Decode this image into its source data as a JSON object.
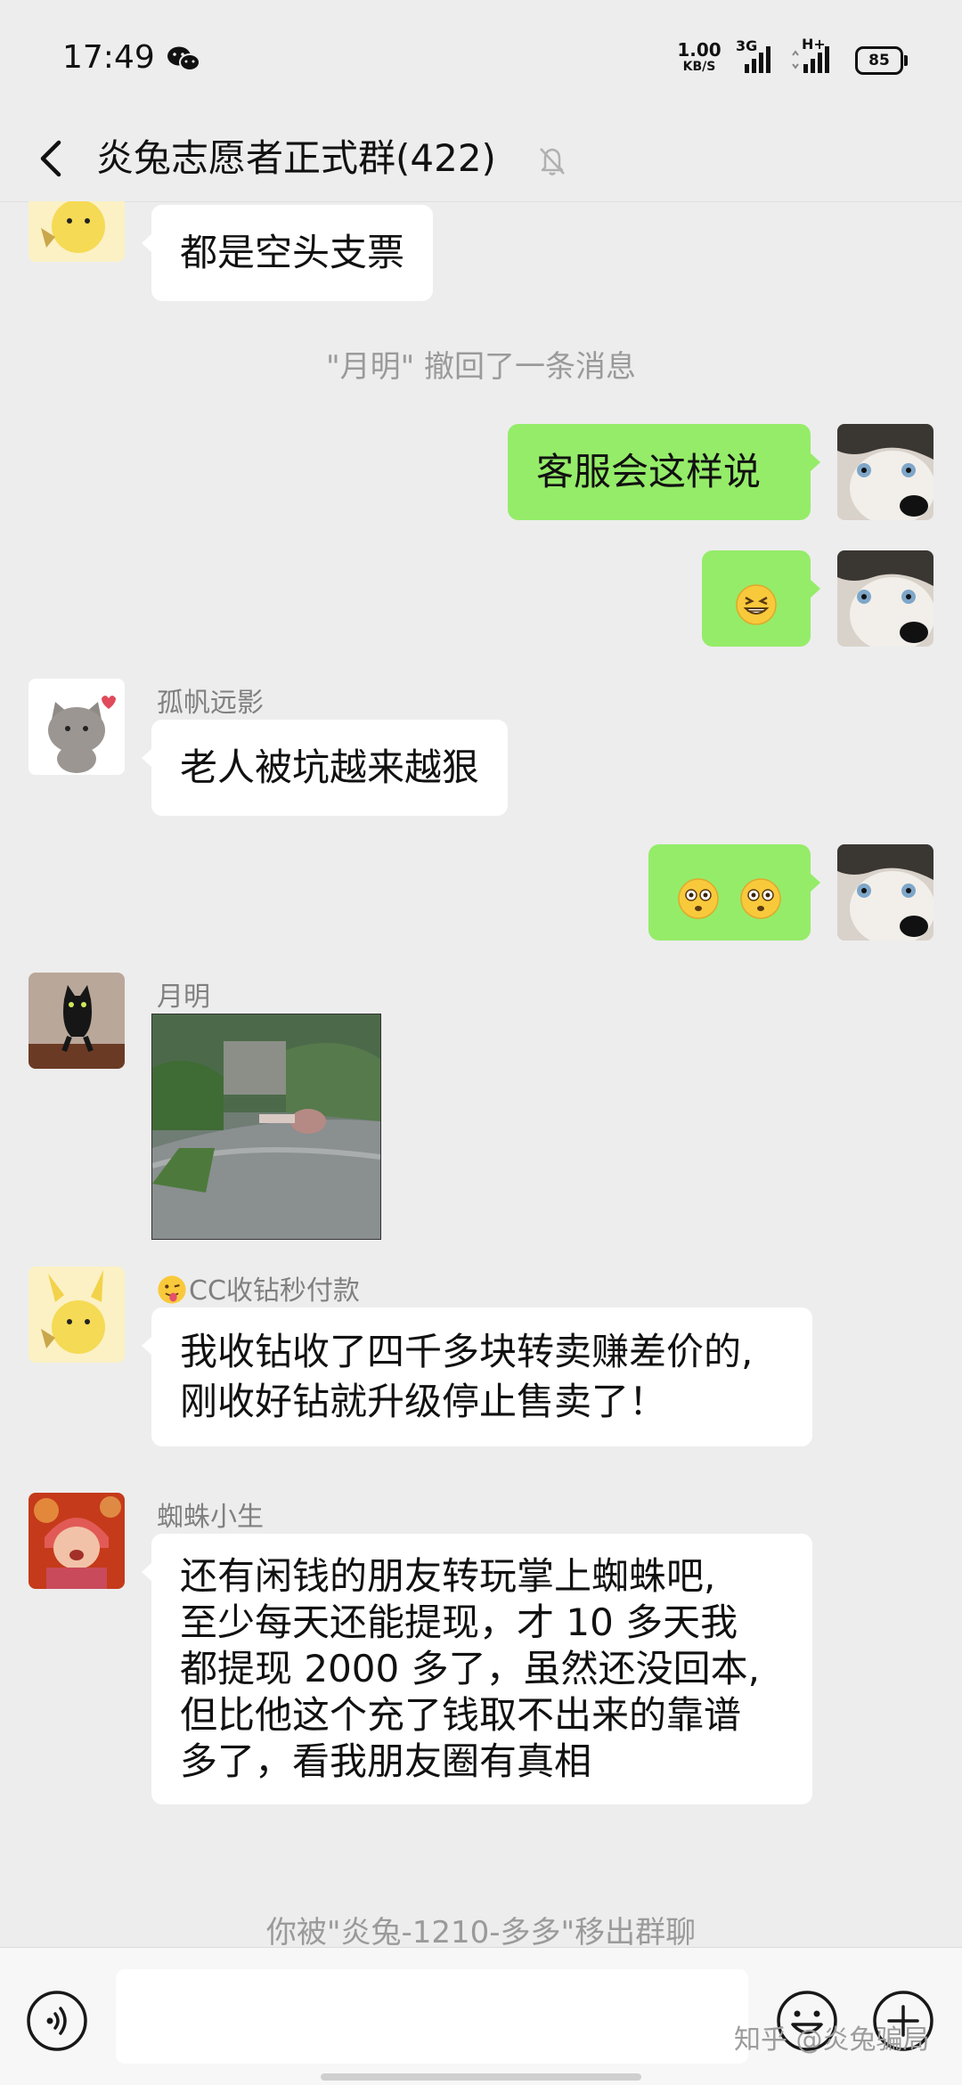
{
  "status_bar": {
    "time": "17:49",
    "speed_value": "1.00",
    "speed_unit": "KB/S",
    "network_1": "3G",
    "network_2": "H+",
    "battery": "85"
  },
  "header": {
    "title": "炎兔志愿者正式群(422)",
    "mute_icon": "bell-mute-icon"
  },
  "messages": [
    {
      "type": "text",
      "side": "left",
      "sender": "",
      "avatar": "pikachu",
      "text": "都是空头支票"
    },
    {
      "type": "system",
      "text": "\"月明\" 撤回了一条消息"
    },
    {
      "type": "text",
      "side": "right",
      "avatar": "husky",
      "text": "客服会这样说"
    },
    {
      "type": "emoji",
      "side": "right",
      "avatar": "husky",
      "emojis": [
        "grinning-squint-emoji"
      ]
    },
    {
      "type": "text",
      "side": "left",
      "sender": "孤帆远影",
      "avatar": "cat-cartoon",
      "text": "老人被坑越来越狠"
    },
    {
      "type": "emoji",
      "side": "right",
      "avatar": "husky",
      "emojis": [
        "flushed-emoji",
        "flushed-emoji"
      ]
    },
    {
      "type": "image",
      "side": "left",
      "sender": "月明",
      "avatar": "black-cat",
      "image": "street-photo"
    },
    {
      "type": "text",
      "side": "left",
      "sender": "CC收钻秒付款",
      "sender_emoji": "tongue-emoji",
      "avatar": "pikachu",
      "lines": [
        "我收钻收了四千多块转卖赚差价的,",
        "刚收好钻就升级停止售卖了！"
      ]
    },
    {
      "type": "text",
      "side": "left",
      "sender": "蜘蛛小生",
      "avatar": "baby",
      "lines": [
        "还有闲钱的朋友转玩掌上蜘蛛吧,",
        "至少每天还能提现，才 10 多天我",
        "都提现 2000 多了，虽然还没回本,",
        "但比他这个充了钱取不出来的靠谱",
        "多了，看我朋友圈有真相"
      ]
    },
    {
      "type": "system",
      "text": "你被\"炎兔-1210-多多\"移出群聊"
    }
  ],
  "input_bar": {
    "voice_icon": "voice-icon",
    "emoji_icon": "emoji-icon",
    "plus_icon": "plus-icon",
    "watermark": "知乎 @炎兔骗局"
  },
  "colors": {
    "background": "#ededed",
    "my_bubble": "#95ec69",
    "other_bubble": "#ffffff",
    "system_text": "#9a9a9a"
  }
}
